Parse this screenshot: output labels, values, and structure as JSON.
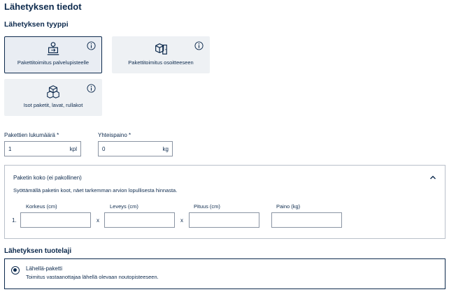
{
  "section_title": "Lähetyksen tiedot",
  "shipment_type": {
    "title": "Lähetyksen tyyppi",
    "options": [
      {
        "label": "Pakettitoimitus palvelupisteelle",
        "icon": "parcel-pickup-point-icon",
        "selected": true
      },
      {
        "label": "Pakettitoimitus osoitteeseen",
        "icon": "parcel-door-icon",
        "selected": false
      },
      {
        "label": "Isot paketit, lavat, rullakot",
        "icon": "stacked-boxes-icon",
        "selected": false
      }
    ],
    "info_icon": "info-icon"
  },
  "quantity": {
    "label": "Pakettien lukumäärä *",
    "value": "1",
    "unit": "kpl"
  },
  "weight": {
    "label": "Yhteispaino *",
    "value": "0",
    "unit": "kg"
  },
  "package_size": {
    "title": "Paketin koko (ei pakollinen)",
    "description": "Syöttämällä paketin koot, näet tarkemman arvion lopullisesta hinnasta.",
    "row_number": "1.",
    "separator": "x",
    "fields": [
      {
        "label": "Korkeus (cm)",
        "value": ""
      },
      {
        "label": "Leveys (cm)",
        "value": ""
      },
      {
        "label": "Pituus (cm)",
        "value": ""
      },
      {
        "label": "Paino (kg)",
        "value": ""
      }
    ]
  },
  "product": {
    "title": "Lähetyksen tuotelaji",
    "selected_option": {
      "name": "Lähellä-paketti",
      "description": "Toimitus vastaanottajaa lähellä olevaan noutopisteeseen."
    }
  },
  "colors": {
    "primary": "#0d2a4d",
    "tile_bg": "#eef1f4",
    "border": "#8a94a3"
  }
}
